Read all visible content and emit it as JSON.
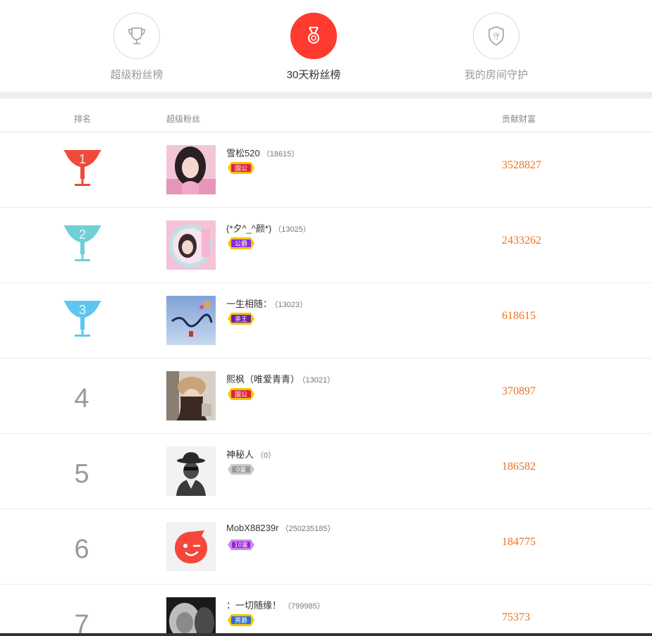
{
  "tabs": [
    {
      "label": "超级粉丝榜",
      "icon": "trophy-icon",
      "active": false
    },
    {
      "label": "30天粉丝榜",
      "icon": "medal-icon",
      "active": true
    },
    {
      "label": "我的房间守护",
      "icon": "shield-guard-icon",
      "active": false
    }
  ],
  "shield_char": "守",
  "header": {
    "rank": "排名",
    "fan": "超级粉丝",
    "wealth": "贡献财富"
  },
  "colors": {
    "accent": "#ff3b2f",
    "wealth": "#f0701e",
    "rank1": "#f04a3a",
    "rank2": "#6fd0d6",
    "rank3": "#5fc6f2"
  },
  "rows": [
    {
      "rank": "1",
      "name": "雪松520",
      "uid": "（18615）",
      "badge": "国公",
      "badge_color": "#d9263e",
      "wealth": "3528827",
      "avatar": "girl-pink-avatar"
    },
    {
      "rank": "2",
      "name": "(*夕^_^颜*)",
      "uid": "（13025）",
      "badge": "公爵",
      "badge_color": "#8a2be2",
      "wealth": "2433262",
      "avatar": "girl-frame-avatar"
    },
    {
      "rank": "3",
      "name": "一生相随：",
      "uid": "（13023）",
      "badge": "亲王",
      "badge_color": "#6a1fb0",
      "wealth": "618615",
      "avatar": "calligraphy-avatar"
    },
    {
      "rank": "4",
      "name": "熙枫（唯爱青青）",
      "uid": "（13021）",
      "badge": "国公",
      "badge_color": "#d9263e",
      "wealth": "370897",
      "avatar": "girl-hat-avatar"
    },
    {
      "rank": "5",
      "name": "神秘人",
      "uid": "（0）",
      "badge": "0富",
      "badge_color": "#9a9a9a",
      "wealth": "186582",
      "avatar": "mystery-man-avatar"
    },
    {
      "rank": "6",
      "name": "MobX88239r",
      "uid": "（250235185）",
      "badge": "10富",
      "badge_color": "#9b1fd6",
      "wealth": "184775",
      "avatar": "wink-face-avatar"
    },
    {
      "rank": "7",
      "name": "：一切随缘！",
      "uid": "（799985）",
      "badge": "男爵",
      "badge_color": "#2d6fd2",
      "wealth": "75373",
      "avatar": "lion-avatar"
    }
  ]
}
